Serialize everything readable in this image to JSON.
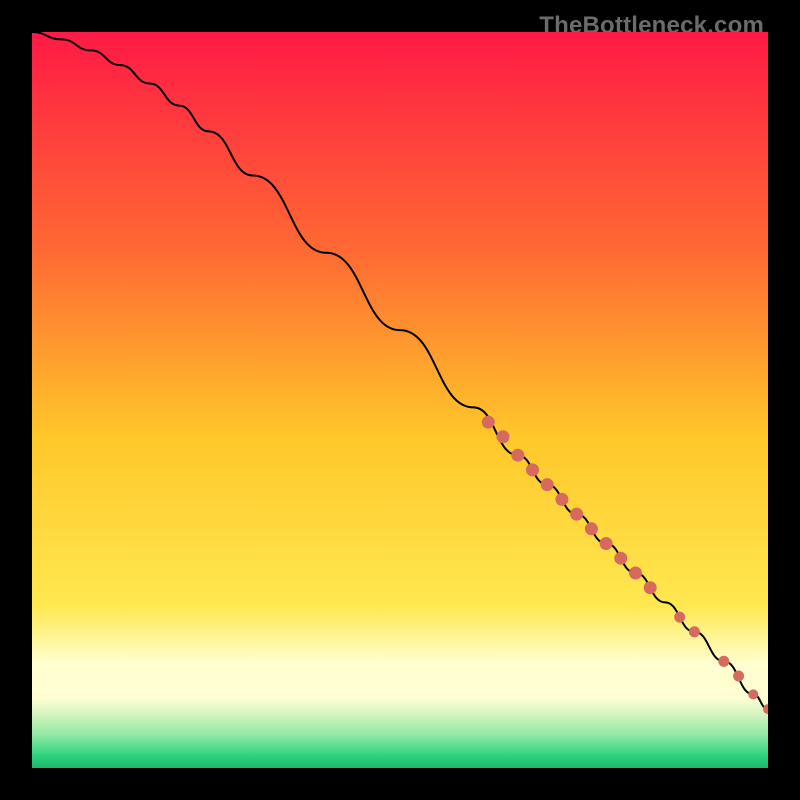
{
  "watermark": "TheBottleneck.com",
  "colors": {
    "frame": "#000000",
    "top_gradient": "#ff1a45",
    "mid1": "#ff7a2e",
    "mid2": "#ffd22d",
    "band_light": "#ffffd2",
    "band_green_light": "#d2f7b9",
    "bottom_green": "#28d17c",
    "curve": "#000000",
    "dots": "#d66a5d"
  },
  "chart_data": {
    "type": "line",
    "title": "",
    "xlabel": "",
    "ylabel": "",
    "xlim": [
      0,
      100
    ],
    "ylim": [
      0,
      100
    ],
    "series": [
      {
        "name": "curve",
        "x": [
          0,
          4,
          8,
          12,
          16,
          20,
          24,
          30,
          40,
          50,
          60,
          66,
          70,
          74,
          78,
          82,
          86,
          90,
          94,
          98,
          100
        ],
        "y": [
          100,
          99,
          97.5,
          95.5,
          93,
          90,
          86.5,
          80.5,
          70,
          59.5,
          49,
          42.5,
          38.5,
          34.5,
          30.5,
          26.5,
          22.5,
          18.5,
          14.5,
          10,
          8
        ]
      }
    ],
    "points": {
      "name": "highlight-dots",
      "x": [
        62,
        64,
        66,
        68,
        70,
        72,
        74,
        76,
        78,
        80,
        82,
        84,
        88,
        90,
        94,
        96,
        98,
        100
      ],
      "y": [
        47,
        45,
        42.5,
        40.5,
        38.5,
        36.5,
        34.5,
        32.5,
        30.5,
        28.5,
        26.5,
        24.5,
        20.5,
        18.5,
        14.5,
        12.5,
        10,
        8
      ],
      "r": [
        6,
        6,
        6,
        6,
        6,
        6,
        6,
        6,
        6,
        6,
        6,
        6,
        5,
        5,
        5,
        5,
        4.5,
        4.5
      ]
    },
    "gradient_stops": [
      {
        "offset": 0.0,
        "color": "#ff1a45"
      },
      {
        "offset": 0.3,
        "color": "#ff6a33"
      },
      {
        "offset": 0.55,
        "color": "#ffc72a"
      },
      {
        "offset": 0.78,
        "color": "#ffe850"
      },
      {
        "offset": 0.86,
        "color": "#ffffd2"
      },
      {
        "offset": 0.905,
        "color": "#ffffd2"
      },
      {
        "offset": 0.925,
        "color": "#d9f6c0"
      },
      {
        "offset": 0.955,
        "color": "#8fe9a5"
      },
      {
        "offset": 0.985,
        "color": "#28d17c"
      },
      {
        "offset": 1.0,
        "color": "#1fb66b"
      }
    ]
  }
}
